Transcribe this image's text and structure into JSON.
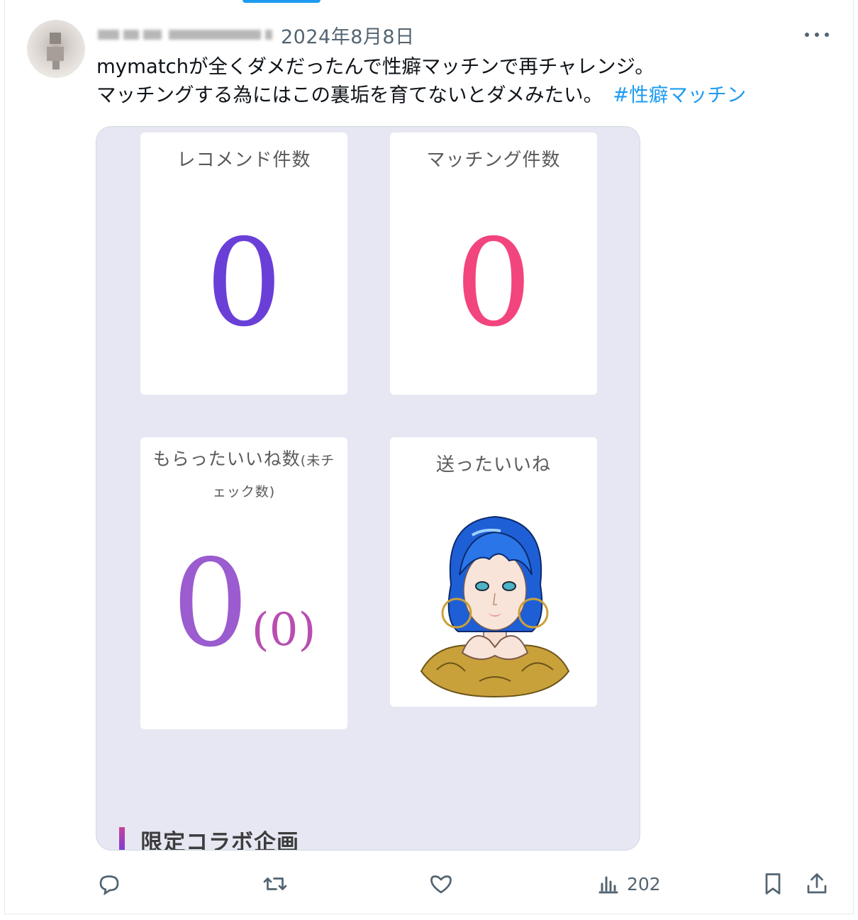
{
  "post": {
    "date": "2024年8月8日",
    "text_line1": "mymatchが全くダメだったんで性癖マッチンで再チャレンジ。",
    "text_line2": "マッチングする為にはこの裏垢を育てないとダメみたい。",
    "hashtag": "#性癖マッチン"
  },
  "media": {
    "cards": [
      {
        "title": "レコメンド件数",
        "value": "0"
      },
      {
        "title": "マッチング件数",
        "value": "0"
      },
      {
        "title": "もらったいいね数",
        "title_small": "(未チェック数)",
        "value": "0",
        "sub_value": "(0)"
      },
      {
        "title": "送ったいいね"
      }
    ],
    "section_title": "限定コラボ企画",
    "colors": {
      "recommend_value": "#6a3fd8",
      "matching_value": "#f2457d",
      "likes_value": "#9b5ccf",
      "background": "#e7e7f3"
    }
  },
  "actions": {
    "views_count": "202",
    "icons": [
      "reply-icon",
      "repost-icon",
      "like-icon",
      "views-icon",
      "bookmark-icon",
      "share-icon"
    ]
  }
}
